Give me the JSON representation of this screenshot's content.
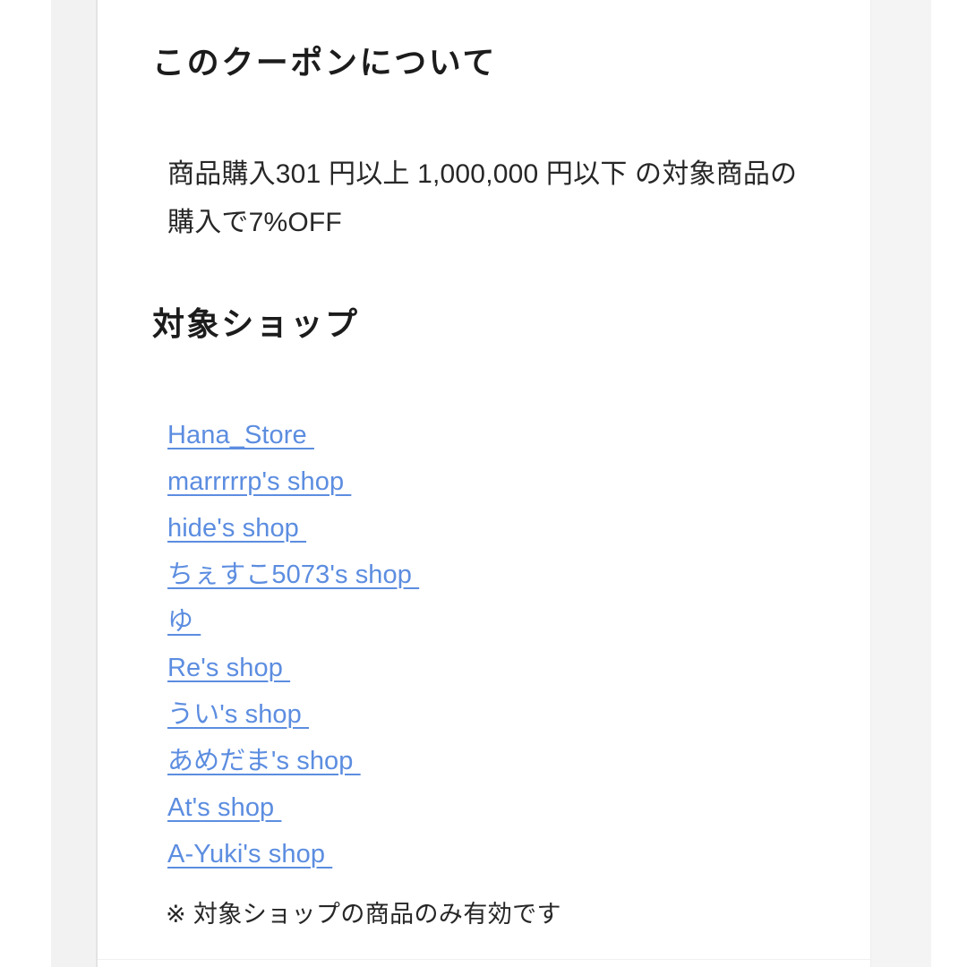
{
  "page": {
    "background_color": "#ffffff",
    "card_color": "#ffffff",
    "gutter_color": "#f2f2f2",
    "link_color": "#5c8de0",
    "text_color": "#272727"
  },
  "about_section": {
    "heading": "このクーポンについて",
    "description": "商品購入301 円以上 1,000,000 円以下 の対象商品の購入で7%OFF",
    "min_purchase": "301 円以上",
    "max_purchase": "1,000,000 円以下",
    "discount": "7%OFF"
  },
  "shops_section": {
    "heading": "対象ショップ",
    "links": [
      {
        "label": "Hana_Store "
      },
      {
        "label": "marrrrrp's shop "
      },
      {
        "label": "hide's shop "
      },
      {
        "label": "ちぇすこ5073's shop "
      },
      {
        "label": "ゆ "
      },
      {
        "label": "Re's shop "
      },
      {
        "label": "うい's shop "
      },
      {
        "label": "あめだま's shop "
      },
      {
        "label": "At's shop "
      },
      {
        "label": "A-Yuki's shop "
      }
    ],
    "note": "※ 対象ショップの商品のみ有効です"
  }
}
